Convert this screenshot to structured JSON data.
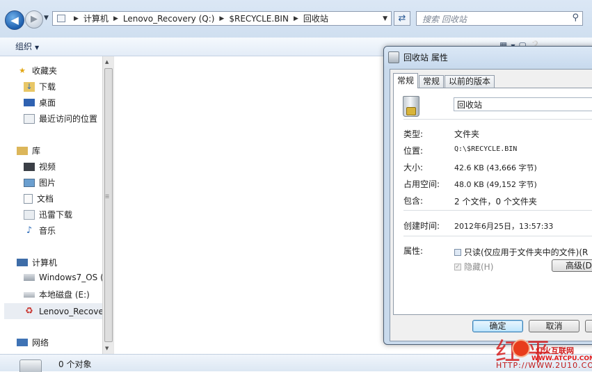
{
  "window": {
    "address": {
      "crumbs": [
        "计算机",
        "Lenovo_Recovery (Q:)",
        "$RECYCLE.BIN",
        "回收站"
      ]
    },
    "search_placeholder": "搜索 回收站",
    "toolbar": {
      "organize_label": "组织"
    },
    "nav": {
      "favorites": {
        "label": "收藏夹",
        "items": [
          "下载",
          "桌面",
          "最近访问的位置"
        ]
      },
      "libraries": {
        "label": "库",
        "items": [
          "视频",
          "图片",
          "文档",
          "迅雷下载",
          "音乐"
        ]
      },
      "computer": {
        "label": "计算机",
        "items": [
          "Windows7_OS (",
          "本地磁盘 (E:)",
          "Lenovo_Recove"
        ]
      },
      "network": {
        "label": "网络"
      }
    },
    "status": {
      "text": "0 个对象"
    }
  },
  "dialog": {
    "title": "回收站 属性",
    "tabs": [
      "常规",
      "常规",
      "以前的版本"
    ],
    "name_value": "回收站",
    "props": {
      "type_label": "类型:",
      "type_value": "文件夹",
      "location_label": "位置:",
      "location_value": "Q:\\$RECYCLE.BIN",
      "size_label": "大小:",
      "size_value": "42.6 KB (43,666 字节)",
      "disk_label": "占用空间:",
      "disk_value": "48.0 KB (49,152 字节)",
      "contains_label": "包含:",
      "contains_value": "2 个文件，0 个文件夹",
      "created_label": "创建时间:",
      "created_value": "2012年6月25日，13:57:33",
      "attributes_label": "属性:",
      "readonly_label": "只读(仅应用于文件夹中的文件)(R",
      "hidden_label": "隐藏(H)",
      "advanced_label": "高级(D"
    },
    "buttons": {
      "ok": "确定",
      "cancel": "取消"
    }
  },
  "watermark": {
    "site_name": "灯火互联网",
    "site_url": "WWW.ATCPU.COM",
    "footer": "HTTP://WWW.2U10.COM"
  }
}
